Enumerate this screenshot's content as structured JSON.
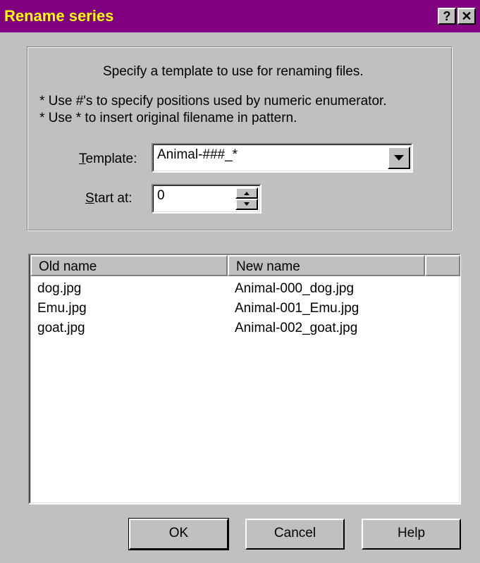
{
  "window": {
    "title": "Rename series",
    "help_glyph": "?",
    "close_glyph": "✕"
  },
  "instructions": {
    "main": "Specify a template to use for renaming files.",
    "note1": "* Use #'s to specify positions used by numeric enumerator.",
    "note2": "* Use * to insert original filename in pattern."
  },
  "template": {
    "label_first": "T",
    "label_rest": "emplate:",
    "value": "Animal-###_*",
    "dropdown_icon": "triangle-down"
  },
  "start_at": {
    "label_first": "S",
    "label_rest": "tart at:",
    "value": "0"
  },
  "list": {
    "columns": [
      "Old name",
      "New name"
    ],
    "rows": [
      {
        "old": "dog.jpg",
        "new": "Animal-000_dog.jpg"
      },
      {
        "old": "Emu.jpg",
        "new": "Animal-001_Emu.jpg"
      },
      {
        "old": "goat.jpg",
        "new": "Animal-002_goat.jpg"
      }
    ]
  },
  "buttons": {
    "ok": "OK",
    "cancel": "Cancel",
    "help": "Help"
  },
  "colors": {
    "titlebar": "#800080",
    "title_text": "#ffff00",
    "face": "#c0c0c0"
  }
}
